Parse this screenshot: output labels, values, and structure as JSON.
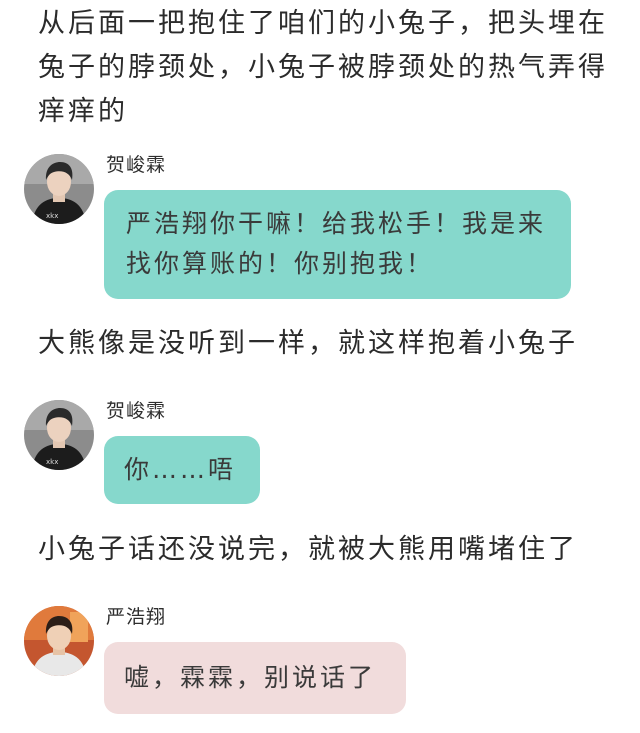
{
  "narration": [
    "从后面一把抱住了咱们的小兔子，把头埋在兔子的脖颈处，小兔子被脖颈处的热气弄得痒痒的",
    "大熊像是没听到一样，就这样抱着小兔子",
    "小兔子话还没说完，就被大熊用嘴堵住了"
  ],
  "messages": [
    {
      "speaker": "贺峻霖",
      "avatar": "avatar-boy-dark-shirt",
      "text": "严浩翔你干嘛！给我松手！我是来找你算账的！你别抱我！",
      "bubble_color": "#86d8cc"
    },
    {
      "speaker": "贺峻霖",
      "avatar": "avatar-boy-dark-shirt",
      "text": "你……唔",
      "bubble_color": "#86d8cc"
    },
    {
      "speaker": "严浩翔",
      "avatar": "avatar-boy-warm-background",
      "text": "嘘，霖霖，别说话了",
      "bubble_color": "#f1dcdc"
    }
  ]
}
